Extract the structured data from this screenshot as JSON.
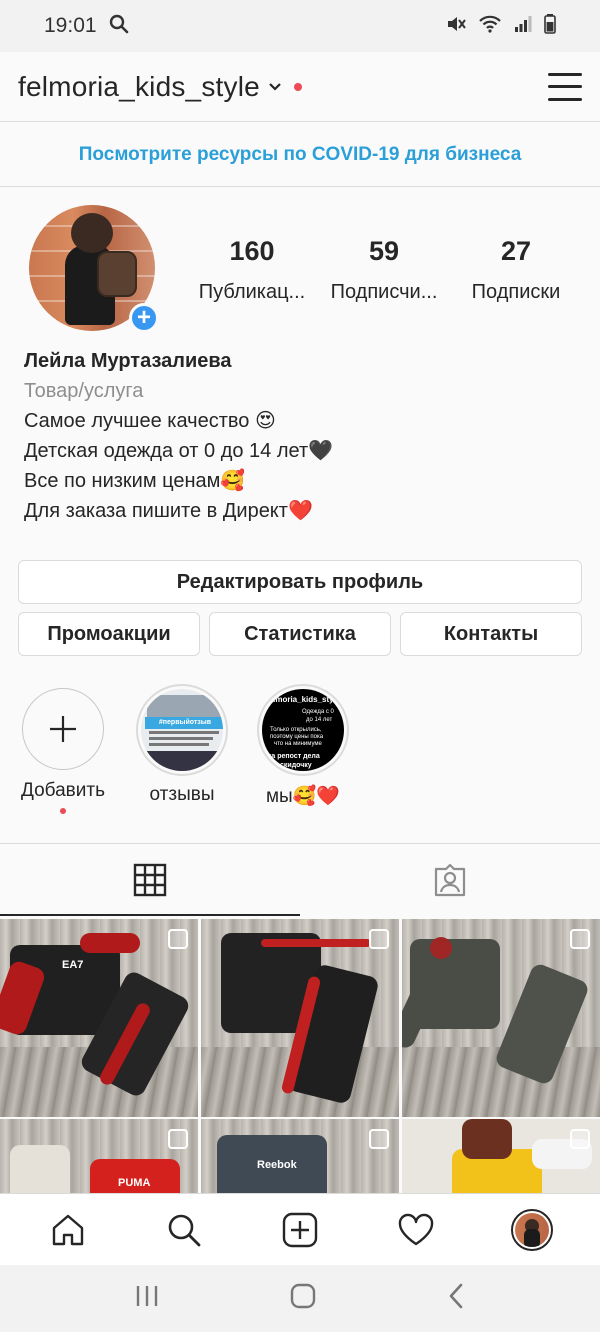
{
  "status_bar": {
    "time": "19:01",
    "icons": [
      "search-icon",
      "mute-icon",
      "wifi-icon",
      "signal-icon",
      "battery-icon"
    ]
  },
  "header": {
    "username": "felmoria_kids_style",
    "icons": [
      "chevron-down-icon",
      "notification-dot",
      "menu-icon"
    ]
  },
  "covid_banner": "Посмотрите ресурсы по COVID-19 для бизнеса",
  "profile": {
    "stats": [
      {
        "value": "160",
        "label": "Публикац..."
      },
      {
        "value": "59",
        "label": "Подписчи..."
      },
      {
        "value": "27",
        "label": "Подписки"
      }
    ],
    "name": "Лейла Муртазалиева",
    "category": "Товар/услуга",
    "bio_lines": [
      "Самое лучшее качество 😍",
      "Детская одежда от 0 до 14 лет🖤",
      "Все по низким ценам🥰",
      "Для заказа пишите в Директ❤️"
    ]
  },
  "buttons": {
    "edit": "Редактировать профиль",
    "promo": "Промоакции",
    "stats": "Статистика",
    "contacts": "Контакты"
  },
  "highlights": [
    {
      "label": "Добавить",
      "icon": "plus-icon"
    },
    {
      "label": "отзывы",
      "icon": "highlight-thumbnail"
    },
    {
      "label": "мы🥰❤️",
      "icon": "highlight-thumbnail"
    }
  ],
  "highlight_texts": {
    "reviews_tag": "#первыйотзыв",
    "us_title": "felmoria_kids_style",
    "us_line1": "Одежда с 0",
    "us_line2": "до 14 лет",
    "us_line3": "Только открылись,",
    "us_line4": "поэтому цены пока",
    "us_line5": "что на минимуме",
    "us_line6": "за репост дела",
    "us_line7": "скидочку"
  },
  "tabs": [
    {
      "name": "grid",
      "icon": "grid-icon",
      "active": true
    },
    {
      "name": "tagged",
      "icon": "tagged-user-icon",
      "active": false
    }
  ],
  "grid_posts": [
    {
      "brand": "EA7"
    },
    {
      "brand": ""
    },
    {
      "brand": ""
    },
    {
      "brand": "PUMA"
    },
    {
      "brand": "Reebok"
    },
    {
      "brand": ""
    }
  ],
  "bottom_nav": [
    "home-icon",
    "search-icon",
    "new-post-icon",
    "activity-heart-icon",
    "profile-avatar"
  ],
  "system_nav": [
    "recent-apps-icon",
    "home-button-icon",
    "back-icon"
  ],
  "colors": {
    "accent_blue": "#3897f0",
    "covid_blue": "#2a9fd8",
    "notification_red": "#ed4956",
    "text": "#262626",
    "muted": "#8e8e8e"
  }
}
